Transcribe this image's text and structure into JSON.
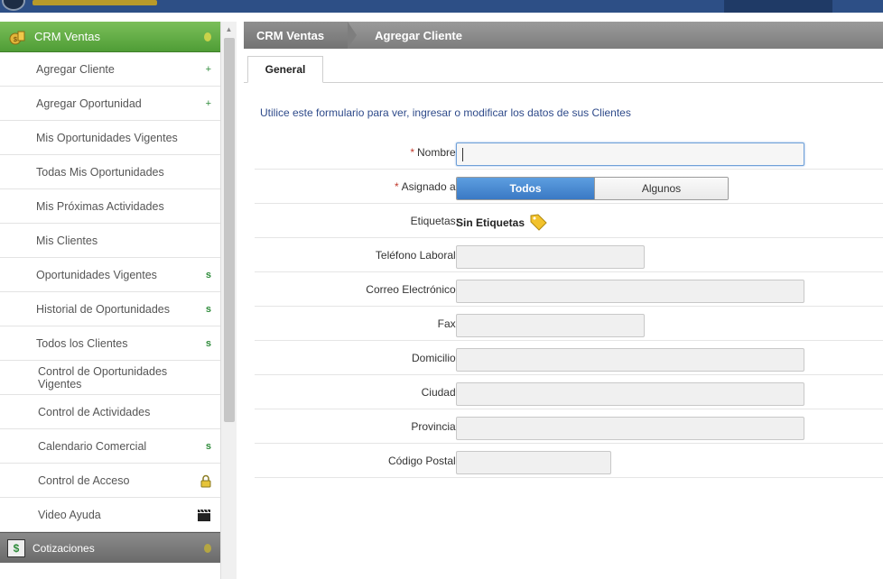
{
  "sidebar": {
    "header": "CRM Ventas",
    "items": [
      {
        "label": "Agregar Cliente",
        "marker": "+"
      },
      {
        "label": "Agregar Oportunidad",
        "marker": "+"
      },
      {
        "label": "Mis Oportunidades Vigentes",
        "marker": ""
      },
      {
        "label": "Todas Mis Oportunidades",
        "marker": ""
      },
      {
        "label": "Mis Próximas Actividades",
        "marker": ""
      },
      {
        "label": "Mis Clientes",
        "marker": ""
      },
      {
        "label": "Oportunidades Vigentes",
        "marker": "s"
      },
      {
        "label": "Historial de Oportunidades",
        "marker": "s"
      },
      {
        "label": "Todos los Clientes",
        "marker": "s"
      },
      {
        "label": "Control de Oportunidades Vigentes",
        "marker": ""
      },
      {
        "label": "Control de Actividades",
        "marker": ""
      },
      {
        "label": "Calendario Comercial",
        "marker": "s"
      },
      {
        "label": "Control de Acceso",
        "marker": "lock-icon"
      },
      {
        "label": "Video Ayuda",
        "marker": "clapperboard-icon"
      }
    ],
    "section2": "Cotizaciones",
    "section2_icon": "$"
  },
  "breadcrumb": {
    "root": "CRM Ventas",
    "current": "Agregar Cliente"
  },
  "tabs": [
    {
      "label": "General"
    }
  ],
  "intro": "Utilice este formulario para ver, ingresar o modificar los datos de sus Clientes",
  "form": {
    "nombre": {
      "label": "Nombre:",
      "required": "*",
      "value": ""
    },
    "asignado": {
      "label": "Asignado a:",
      "required": "*",
      "option_on": "Todos",
      "option_off": "Algunos"
    },
    "etiquetas": {
      "label": "Etiquetas:",
      "value": "Sin Etiquetas"
    },
    "telefono": {
      "label": "Teléfono Laboral:",
      "value": ""
    },
    "correo": {
      "label": "Correo Electrónico:",
      "value": ""
    },
    "fax": {
      "label": "Fax:",
      "value": ""
    },
    "domicilio": {
      "label": "Domicilio:",
      "value": ""
    },
    "ciudad": {
      "label": "Ciudad:",
      "value": ""
    },
    "provincia": {
      "label": "Provincia:",
      "value": ""
    },
    "codigo_postal": {
      "label": "Código Postal:",
      "value": ""
    }
  },
  "colors": {
    "sidebar_header": "#4f9d36",
    "accent_blue": "#3a79c4",
    "breadcrumb_bg": "#7d7d7d",
    "intro_text": "#2e4a8a"
  }
}
